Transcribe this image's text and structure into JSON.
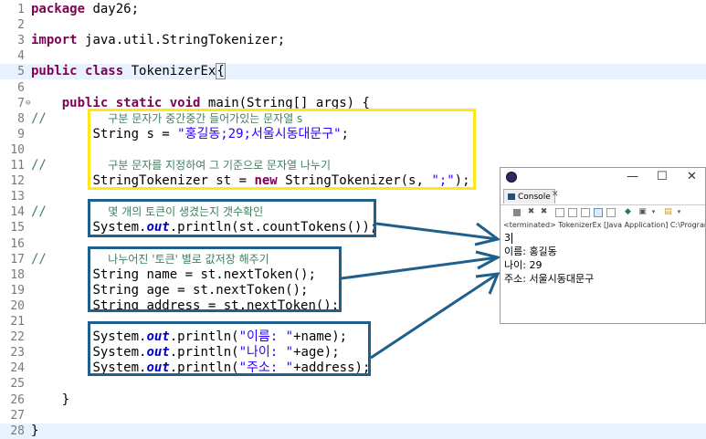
{
  "editor": {
    "lines": [
      {
        "n": "1",
        "parts": [
          [
            "kw",
            "package"
          ],
          [
            "",
            "day26;"
          ]
        ]
      },
      {
        "n": "2",
        "parts": []
      },
      {
        "n": "3",
        "parts": [
          [
            "kw",
            "import"
          ],
          [
            "",
            "java.util.StringTokenizer;"
          ]
        ]
      },
      {
        "n": "4",
        "parts": []
      },
      {
        "n": "5",
        "parts": [
          [
            "kw",
            "public"
          ],
          [
            "kw",
            "class"
          ],
          [
            "",
            "TokenizerEx"
          ],
          [
            "brace",
            "{"
          ]
        ],
        "hl": true
      },
      {
        "n": "6",
        "parts": []
      },
      {
        "n": "7",
        "fold": "⊖",
        "parts": [
          [
            "sp",
            "    "
          ],
          [
            "kw",
            "public"
          ],
          [
            "kw",
            "static"
          ],
          [
            "kw",
            "void"
          ],
          [
            "",
            "main(String[] args) {"
          ]
        ]
      },
      {
        "n": "8",
        "parts": [
          [
            "cm",
            "//        "
          ],
          [
            "cmk",
            "구분 문자가 중간중간 들어가있는 문자열 s"
          ]
        ]
      },
      {
        "n": "9",
        "parts": [
          [
            "sp",
            "        "
          ],
          [
            "",
            "String s = "
          ],
          [
            "str",
            "\"홍길동;29;서울시동대문구\""
          ],
          [
            "",
            ";"
          ]
        ]
      },
      {
        "n": "10",
        "parts": []
      },
      {
        "n": "11",
        "parts": [
          [
            "cm",
            "//        "
          ],
          [
            "cmk",
            "구분 문자를 지정하여 그 기준으로 문자열 나누기"
          ]
        ]
      },
      {
        "n": "12",
        "parts": [
          [
            "sp",
            "        "
          ],
          [
            "",
            "StringTokenizer st = "
          ],
          [
            "kw",
            "new"
          ],
          [
            "",
            "StringTokenizer(s, "
          ],
          [
            "str",
            "\";\""
          ],
          [
            "",
            ");"
          ]
        ]
      },
      {
        "n": "13",
        "parts": []
      },
      {
        "n": "14",
        "parts": [
          [
            "cm",
            "//        "
          ],
          [
            "cmk",
            "몇 개의 토큰이 생겼는지 갯수확인"
          ]
        ]
      },
      {
        "n": "15",
        "parts": [
          [
            "sp",
            "        "
          ],
          [
            "",
            "System."
          ],
          [
            "it",
            "out"
          ],
          [
            "",
            ".println(st.countTokens());"
          ]
        ]
      },
      {
        "n": "16",
        "parts": []
      },
      {
        "n": "17",
        "parts": [
          [
            "cm",
            "//        "
          ],
          [
            "cmk",
            "나누어진 '토큰' 별로 값저장 해주기"
          ]
        ]
      },
      {
        "n": "18",
        "parts": [
          [
            "sp",
            "        "
          ],
          [
            "",
            "String name = st.nextToken();"
          ]
        ]
      },
      {
        "n": "19",
        "parts": [
          [
            "sp",
            "        "
          ],
          [
            "",
            "String age = st.nextToken();"
          ]
        ]
      },
      {
        "n": "20",
        "parts": [
          [
            "sp",
            "        "
          ],
          [
            "",
            "String address = st.nextToken();"
          ]
        ]
      },
      {
        "n": "21",
        "parts": []
      },
      {
        "n": "22",
        "parts": [
          [
            "sp",
            "        "
          ],
          [
            "",
            "System."
          ],
          [
            "it",
            "out"
          ],
          [
            "",
            ".println("
          ],
          [
            "str",
            "\"이름: \""
          ],
          [
            "",
            "+name);"
          ]
        ]
      },
      {
        "n": "23",
        "parts": [
          [
            "sp",
            "        "
          ],
          [
            "",
            "System."
          ],
          [
            "it",
            "out"
          ],
          [
            "",
            ".println("
          ],
          [
            "str",
            "\"나이: \""
          ],
          [
            "",
            "+age);"
          ]
        ]
      },
      {
        "n": "24",
        "parts": [
          [
            "sp",
            "        "
          ],
          [
            "",
            "System."
          ],
          [
            "it",
            "out"
          ],
          [
            "",
            ".println("
          ],
          [
            "str",
            "\"주소: \""
          ],
          [
            "",
            "+address);"
          ]
        ]
      },
      {
        "n": "25",
        "parts": []
      },
      {
        "n": "26",
        "parts": [
          [
            "sp",
            "    "
          ],
          [
            "",
            "}"
          ]
        ]
      },
      {
        "n": "27",
        "parts": []
      },
      {
        "n": "28",
        "parts": [
          [
            "",
            "}"
          ]
        ],
        "hl": true
      }
    ]
  },
  "console": {
    "tab_label": "Console",
    "tab_close": "✕",
    "terminated_text": "<terminated> TokenizerEx [Java Application] C:\\Program",
    "output": [
      "3",
      "이름:  홍길동",
      "나이:  29",
      "주소:  서울시동대문구"
    ],
    "window_buttons": {
      "minimize": "—",
      "maximize": "☐",
      "close": "✕"
    }
  },
  "colors": {
    "keyword": "#7f0055",
    "string": "#2a00ff",
    "comment": "#3f7f5f",
    "field": "#0000c0",
    "highlight_box": "#ffe81a",
    "annotation_box": "#1f5f8b"
  }
}
